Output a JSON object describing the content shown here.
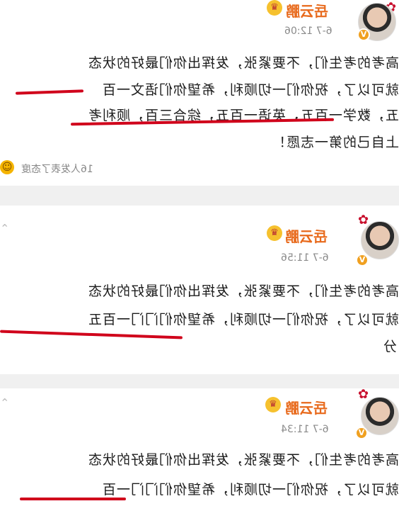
{
  "posts": [
    {
      "username": "岳云鹏",
      "time": "6-7 12:06",
      "lines": [
        "高考的考生们，不要紧张，发挥出你们最好的状态",
        "就可以了，祝你们一切顺利，希望你们语文一百",
        "五，数学一百五，英语一百五，综合三百，顺利考",
        "上自己的第一志愿！"
      ],
      "likes_text": "16人发表了态度"
    },
    {
      "username": "岳云鹏",
      "time": "6-7 11:56",
      "lines": [
        "高考的考生们，不要紧张，发挥出你们最好的状态",
        "就可以了，祝你们一切顺利，希望你们门门一百五",
        "分"
      ]
    },
    {
      "username": "岳云鹏",
      "time": "6-7 11:34",
      "lines": [
        "高考的考生们，不要紧张，发挥出你们最好的状态",
        "就可以了，祝你们一切顺利，希望你们门门一百"
      ]
    }
  ],
  "icons": {
    "verified": "verified-badge-icon",
    "crown": "crown-icon",
    "flower": "flower-icon",
    "smiley": "smiley-icon",
    "chevron": "chevron-down-icon"
  },
  "colors": {
    "username": "#e86a1c",
    "annotation": "#d0021b",
    "timestamp": "#8a8a8a"
  }
}
